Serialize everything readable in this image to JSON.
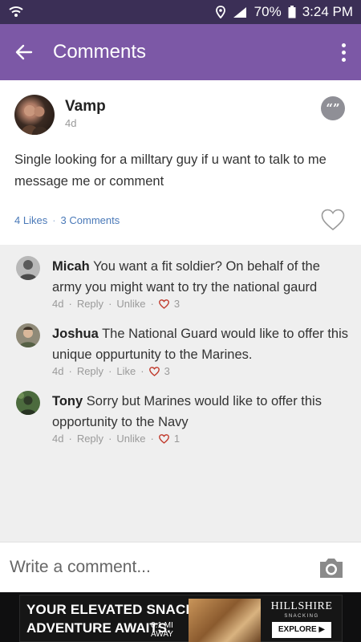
{
  "status_bar": {
    "battery": "70%",
    "time": "3:24 PM",
    "network": "LTE"
  },
  "app_bar": {
    "title": "Comments"
  },
  "post": {
    "author": "Vamp",
    "time": "4d",
    "body": "Single looking for a milltary guy if u want to talk to me message me or comment",
    "likes_label": "4 Likes",
    "separator": "·",
    "comments_label": "3 Comments"
  },
  "comments": [
    {
      "author": "Micah",
      "text": "You want a fit soldier? On behalf of the army you might want to try the national gaurd",
      "time": "4d",
      "reply": "Reply",
      "like_action": "Unlike",
      "likes": "3"
    },
    {
      "author": "Joshua",
      "text": "The National Guard would like to offer this unique oppurtunity to the Marines.",
      "time": "4d",
      "reply": "Reply",
      "like_action": "Like",
      "likes": "3"
    },
    {
      "author": "Tony",
      "text": "Sorry but Marines would like to offer this opportunity to the Navy",
      "time": "4d",
      "reply": "Reply",
      "like_action": "Unlike",
      "likes": "1"
    }
  ],
  "compose": {
    "placeholder": "Write a comment..."
  },
  "ad": {
    "headline_1": "YOUR ELEVATED SNACKING",
    "headline_2": "ADVENTURE AWAITS.",
    "distance_1": "0.1 MI",
    "distance_2": "AWAY",
    "brand": "HILLSHIRE",
    "brand_sub": "SNACKING",
    "cta": "EXPLORE ▶"
  },
  "colors": {
    "status_bar": "#3b2f56",
    "app_bar": "#7c58a6",
    "link": "#4a79b8",
    "heart": "#c0392b"
  }
}
